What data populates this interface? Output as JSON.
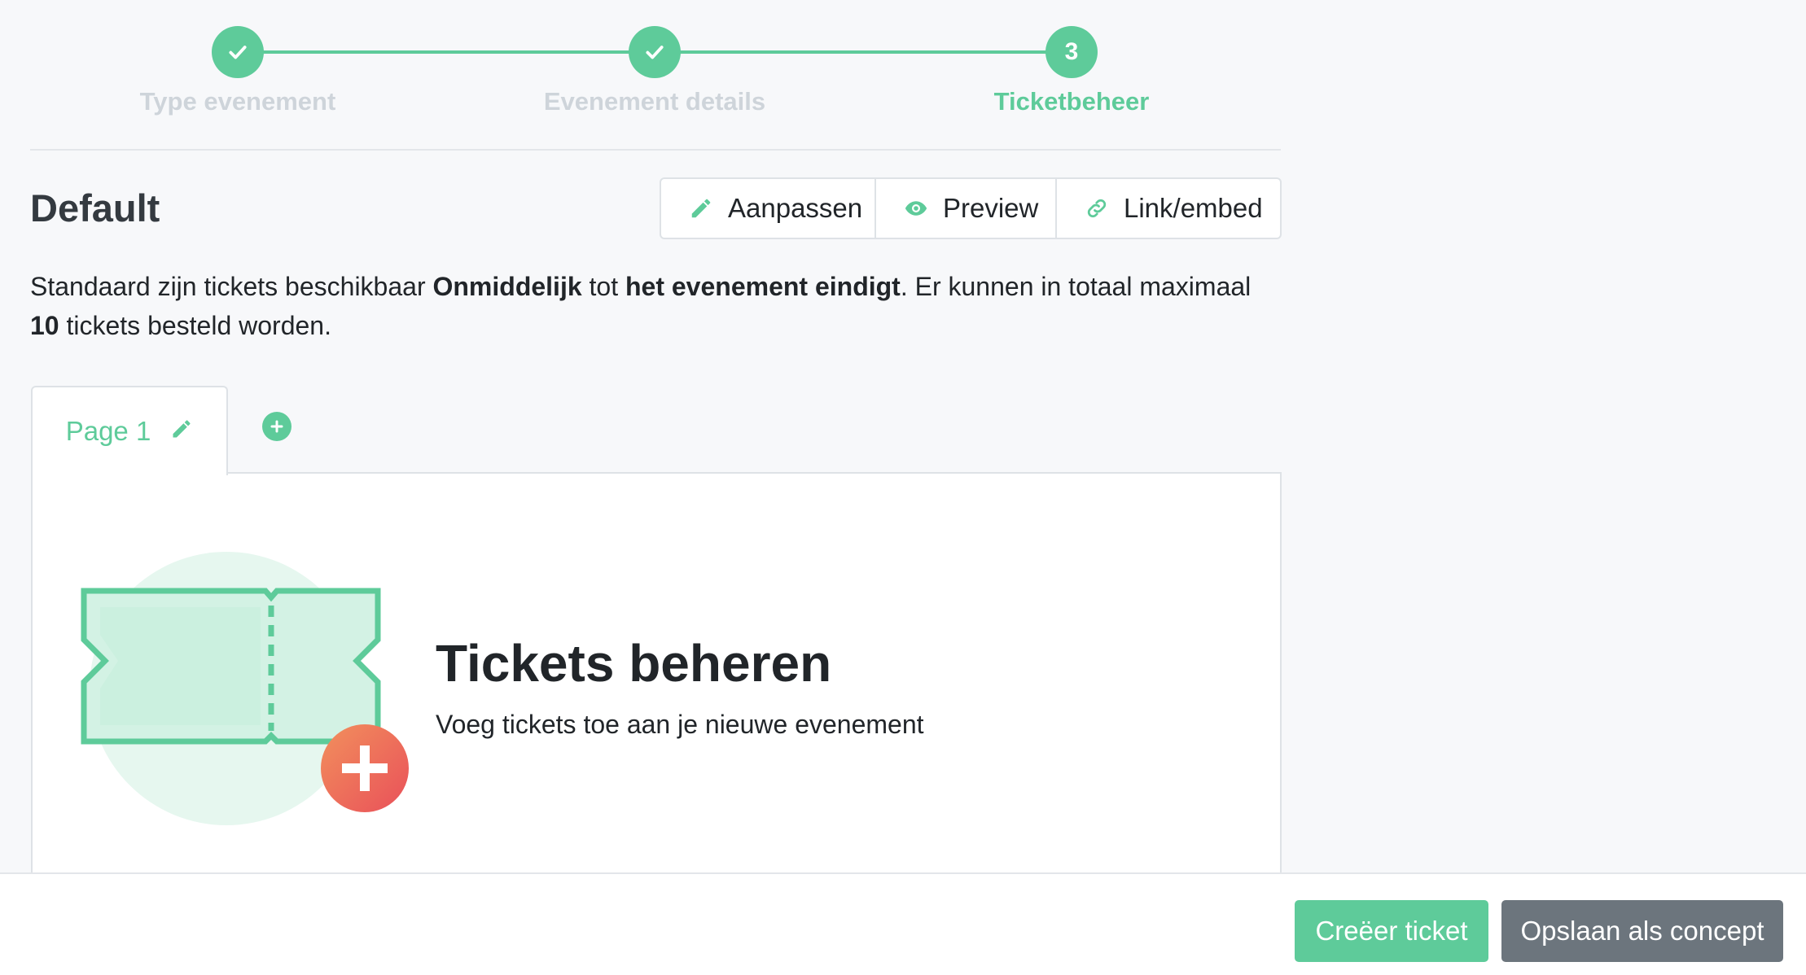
{
  "stepper": {
    "steps": [
      {
        "label": "Type evenement",
        "marker": "check-icon",
        "status": "done"
      },
      {
        "label": "Evenement details",
        "marker": "check-icon",
        "status": "done"
      },
      {
        "label": "Ticketbeheer",
        "marker": "3",
        "status": "active"
      }
    ]
  },
  "header": {
    "title": "Default",
    "actions": {
      "edit": {
        "label": "Aanpassen",
        "icon": "pencil-icon"
      },
      "preview": {
        "label": "Preview",
        "icon": "eye-icon"
      },
      "link": {
        "label": "Link/embed",
        "icon": "link-icon"
      }
    }
  },
  "info": {
    "part1": "Standaard zijn tickets beschikbaar ",
    "bold1": "Onmiddelijk",
    "part2": " tot ",
    "bold2": "het evenement eindigt",
    "part3": ". Er kunnen in totaal maximaal ",
    "bold3": "10",
    "part4": " tickets besteld worden."
  },
  "tabs": {
    "pages": [
      {
        "label": "Page 1",
        "icon": "pencil-icon"
      }
    ],
    "add_icon": "plus-circle-icon"
  },
  "empty_state": {
    "title": "Tickets beheren",
    "subtitle": "Voeg tickets toe aan je nieuwe evenement",
    "illustration": "ticket-plus-illustration"
  },
  "footer": {
    "create_label": "Creëer ticket",
    "save_label": "Opslaan als concept"
  },
  "colors": {
    "accent": "#5ecb9a",
    "secondary": "#6c757d",
    "badge_red": "#ea5a5a",
    "badge_orange": "#f2905c"
  }
}
